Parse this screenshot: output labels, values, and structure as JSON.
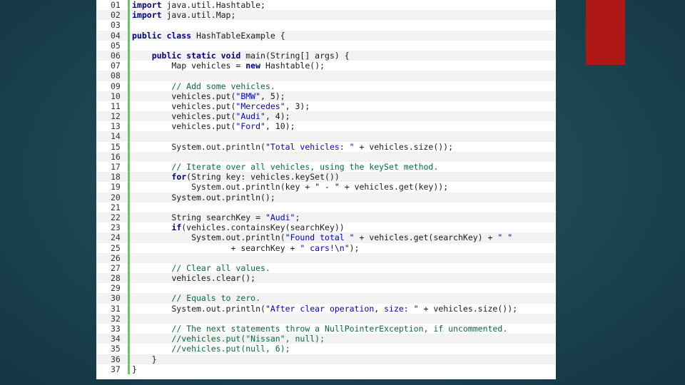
{
  "colors": {
    "accent": "#b01717",
    "background": "#1c4452",
    "panel": "#ffffff",
    "gutter_bar": "#6ac46a"
  },
  "code": {
    "lines": [
      {
        "n": "01",
        "tokens": [
          {
            "t": "kw",
            "v": "import"
          },
          {
            "t": "p",
            "v": " java.util.Hashtable;"
          }
        ]
      },
      {
        "n": "02",
        "tokens": [
          {
            "t": "kw",
            "v": "import"
          },
          {
            "t": "p",
            "v": " java.util.Map;"
          }
        ]
      },
      {
        "n": "03",
        "tokens": []
      },
      {
        "n": "04",
        "tokens": [
          {
            "t": "kw",
            "v": "public class"
          },
          {
            "t": "p",
            "v": " HashTableExample {"
          }
        ]
      },
      {
        "n": "05",
        "tokens": []
      },
      {
        "n": "06",
        "tokens": [
          {
            "t": "p",
            "v": "    "
          },
          {
            "t": "kw",
            "v": "public static void"
          },
          {
            "t": "p",
            "v": " main(String[] args) {"
          }
        ]
      },
      {
        "n": "07",
        "tokens": [
          {
            "t": "p",
            "v": "        Map vehicles = "
          },
          {
            "t": "kw",
            "v": "new"
          },
          {
            "t": "p",
            "v": " Hashtable();"
          }
        ]
      },
      {
        "n": "08",
        "tokens": []
      },
      {
        "n": "09",
        "tokens": [
          {
            "t": "p",
            "v": "        "
          },
          {
            "t": "cmt",
            "v": "// Add some vehicles."
          }
        ]
      },
      {
        "n": "10",
        "tokens": [
          {
            "t": "p",
            "v": "        vehicles.put("
          },
          {
            "t": "str",
            "v": "\"BMW\""
          },
          {
            "t": "p",
            "v": ", 5);"
          }
        ]
      },
      {
        "n": "11",
        "tokens": [
          {
            "t": "p",
            "v": "        vehicles.put("
          },
          {
            "t": "str",
            "v": "\"Mercedes\""
          },
          {
            "t": "p",
            "v": ", 3);"
          }
        ]
      },
      {
        "n": "12",
        "tokens": [
          {
            "t": "p",
            "v": "        vehicles.put("
          },
          {
            "t": "str",
            "v": "\"Audi\""
          },
          {
            "t": "p",
            "v": ", 4);"
          }
        ]
      },
      {
        "n": "13",
        "tokens": [
          {
            "t": "p",
            "v": "        vehicles.put("
          },
          {
            "t": "str",
            "v": "\"Ford\""
          },
          {
            "t": "p",
            "v": ", 10);"
          }
        ]
      },
      {
        "n": "14",
        "tokens": []
      },
      {
        "n": "15",
        "tokens": [
          {
            "t": "p",
            "v": "        System.out.println("
          },
          {
            "t": "str",
            "v": "\"Total vehicles: \""
          },
          {
            "t": "p",
            "v": " + vehicles.size());"
          }
        ]
      },
      {
        "n": "16",
        "tokens": []
      },
      {
        "n": "17",
        "tokens": [
          {
            "t": "p",
            "v": "        "
          },
          {
            "t": "cmt",
            "v": "// Iterate over all vehicles, using the keySet method."
          }
        ]
      },
      {
        "n": "18",
        "tokens": [
          {
            "t": "p",
            "v": "        "
          },
          {
            "t": "kw",
            "v": "for"
          },
          {
            "t": "p",
            "v": "(String key: vehicles.keySet())"
          }
        ]
      },
      {
        "n": "19",
        "tokens": [
          {
            "t": "p",
            "v": "            System.out.println(key + "
          },
          {
            "t": "str",
            "v": "\" - \""
          },
          {
            "t": "p",
            "v": " + vehicles.get(key));"
          }
        ]
      },
      {
        "n": "20",
        "tokens": [
          {
            "t": "p",
            "v": "        System.out.println();"
          }
        ]
      },
      {
        "n": "21",
        "tokens": []
      },
      {
        "n": "22",
        "tokens": [
          {
            "t": "p",
            "v": "        String searchKey = "
          },
          {
            "t": "str",
            "v": "\"Audi\""
          },
          {
            "t": "p",
            "v": ";"
          }
        ]
      },
      {
        "n": "23",
        "tokens": [
          {
            "t": "p",
            "v": "        "
          },
          {
            "t": "kw",
            "v": "if"
          },
          {
            "t": "p",
            "v": "(vehicles.containsKey(searchKey))"
          }
        ]
      },
      {
        "n": "24",
        "tokens": [
          {
            "t": "p",
            "v": "            System.out.println("
          },
          {
            "t": "str",
            "v": "\"Found total \""
          },
          {
            "t": "p",
            "v": " + vehicles.get(searchKey) + "
          },
          {
            "t": "str",
            "v": "\" \""
          }
        ]
      },
      {
        "n": "25",
        "tokens": [
          {
            "t": "p",
            "v": "                    + searchKey + "
          },
          {
            "t": "str",
            "v": "\" cars!\\n\""
          },
          {
            "t": "p",
            "v": ");"
          }
        ]
      },
      {
        "n": "26",
        "tokens": []
      },
      {
        "n": "27",
        "tokens": [
          {
            "t": "p",
            "v": "        "
          },
          {
            "t": "cmt",
            "v": "// Clear all values."
          }
        ]
      },
      {
        "n": "28",
        "tokens": [
          {
            "t": "p",
            "v": "        vehicles.clear();"
          }
        ]
      },
      {
        "n": "29",
        "tokens": []
      },
      {
        "n": "30",
        "tokens": [
          {
            "t": "p",
            "v": "        "
          },
          {
            "t": "cmt",
            "v": "// Equals to zero."
          }
        ]
      },
      {
        "n": "31",
        "tokens": [
          {
            "t": "p",
            "v": "        System.out.println("
          },
          {
            "t": "str",
            "v": "\"After clear operation, size: \""
          },
          {
            "t": "p",
            "v": " + vehicles.size());"
          }
        ]
      },
      {
        "n": "32",
        "tokens": []
      },
      {
        "n": "33",
        "tokens": [
          {
            "t": "p",
            "v": "        "
          },
          {
            "t": "cmt",
            "v": "// The next statements throw a NullPointerException, if uncommented."
          }
        ]
      },
      {
        "n": "34",
        "tokens": [
          {
            "t": "p",
            "v": "        "
          },
          {
            "t": "cmt",
            "v": "//vehicles.put(\"Nissan\", null);"
          }
        ]
      },
      {
        "n": "35",
        "tokens": [
          {
            "t": "p",
            "v": "        "
          },
          {
            "t": "cmt",
            "v": "//vehicles.put(null, 6);"
          }
        ]
      },
      {
        "n": "36",
        "tokens": [
          {
            "t": "p",
            "v": "    }"
          }
        ]
      },
      {
        "n": "37",
        "tokens": [
          {
            "t": "p",
            "v": "}"
          }
        ]
      }
    ]
  }
}
